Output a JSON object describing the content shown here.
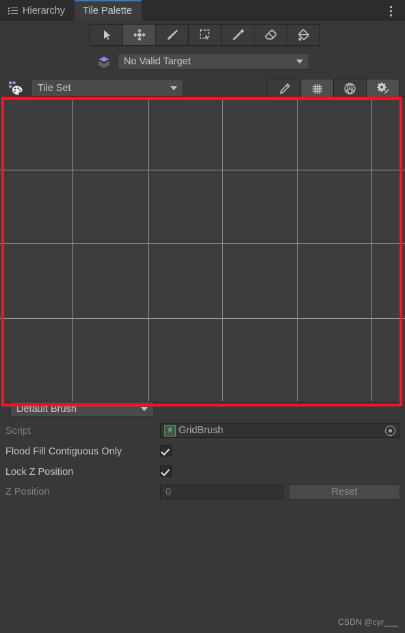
{
  "window": {
    "tabs": [
      {
        "label": "Hierarchy",
        "icon": "hierarchy-icon",
        "active": false
      },
      {
        "label": "Tile Palette",
        "icon": "",
        "active": true
      }
    ],
    "menu_icon": "kebab-menu-icon"
  },
  "toolbar": {
    "tools": [
      {
        "name": "select-tool",
        "icon": "cursor-arrow-icon",
        "active": false
      },
      {
        "name": "move-tool",
        "icon": "move-arrows-icon",
        "active": true
      },
      {
        "name": "paint-tool",
        "icon": "paintbrush-icon",
        "active": false
      },
      {
        "name": "box-fill-tool",
        "icon": "box-select-icon",
        "active": false
      },
      {
        "name": "picker-tool",
        "icon": "eyedropper-icon",
        "active": false
      },
      {
        "name": "erase-tool",
        "icon": "eraser-icon",
        "active": false
      },
      {
        "name": "fill-tool",
        "icon": "paint-bucket-icon",
        "active": false
      }
    ]
  },
  "target": {
    "icon": "tilemap-layers-icon",
    "value": "No Valid Target",
    "caret": "chevron-down-icon"
  },
  "palette": {
    "icon": "tile-palette-icon",
    "value": "Tile Set",
    "caret": "chevron-down-icon",
    "right_tools": [
      {
        "name": "edit-palette-button",
        "icon": "pencil-icon",
        "active": false
      },
      {
        "name": "grid-toggle-button",
        "icon": "grid-icon",
        "active": true
      },
      {
        "name": "gizmo-toggle-button",
        "icon": "gizmo-icon",
        "active": false
      },
      {
        "name": "settings-button",
        "icon": "gear-brush-icon",
        "active": true
      }
    ]
  },
  "canvas": {
    "name": "tile-palette-canvas",
    "grid_color": "#a0a0a0",
    "background": "#3c3c3c",
    "vertical_lines": [
      106,
      217,
      325,
      434,
      543
    ],
    "horizontal_lines": [
      102,
      209,
      319
    ]
  },
  "annotation": {
    "name": "red-highlight-rectangle",
    "color": "#ff1122"
  },
  "brush": {
    "dropdown_value": "Default Brush",
    "caret": "chevron-down-icon",
    "script": {
      "label": "Script",
      "value": "GridBrush",
      "icon": "cs-script-icon",
      "picker": "object-picker-icon"
    },
    "flood_fill": {
      "label": "Flood Fill Contiguous Only",
      "checked": true
    },
    "lock_z": {
      "label": "Lock Z Position",
      "checked": true
    },
    "z_position": {
      "label": "Z Position",
      "value": "0",
      "reset_label": "Reset",
      "disabled": true
    }
  },
  "watermark": {
    "text": "CSDN @cyr___"
  }
}
